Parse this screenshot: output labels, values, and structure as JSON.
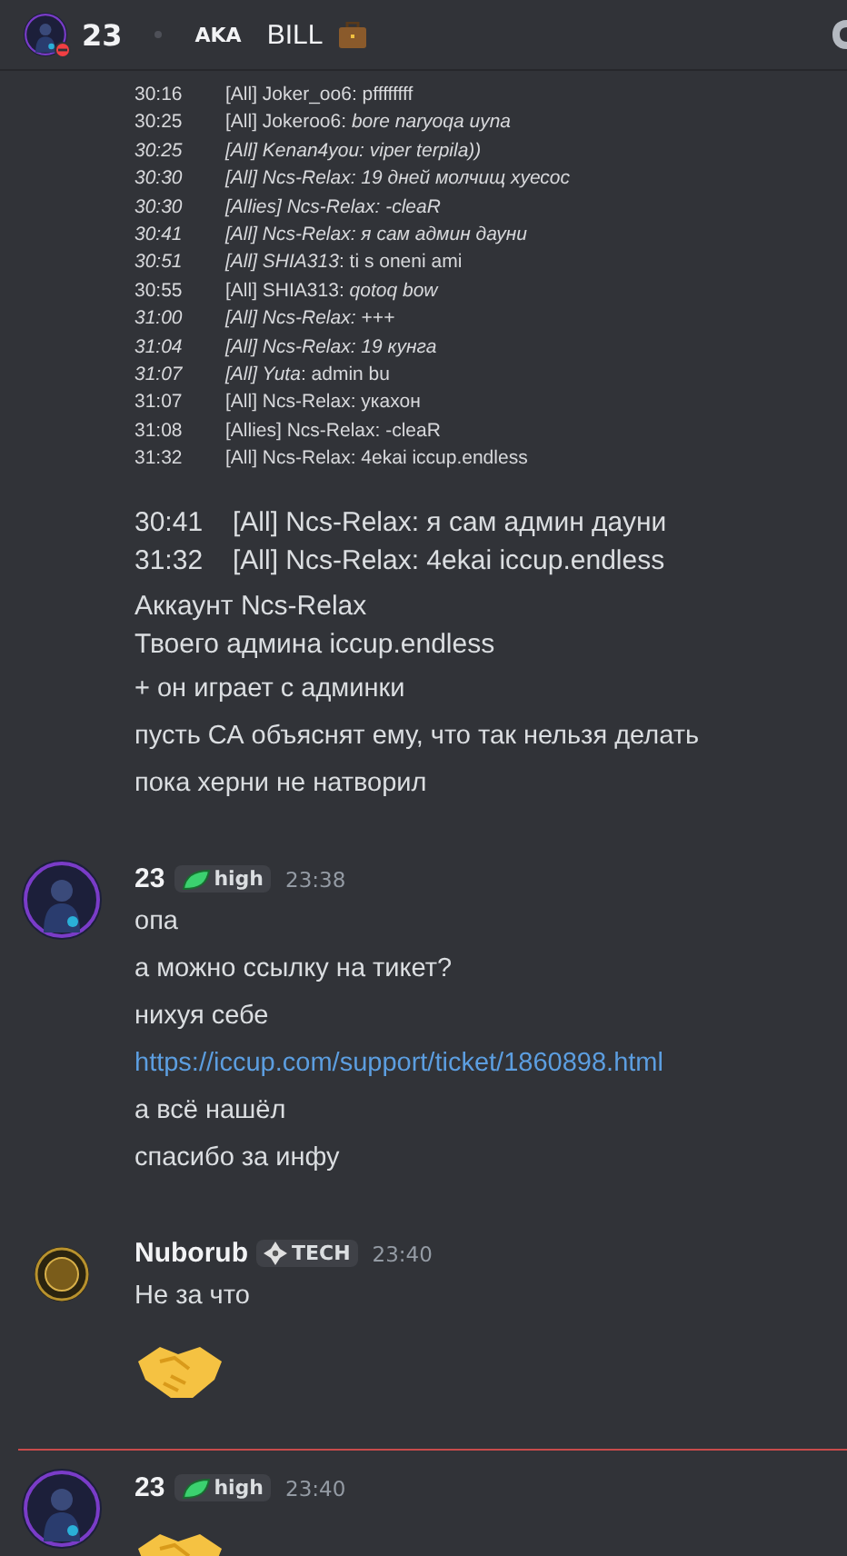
{
  "header": {
    "name": "23",
    "tag": "AKA",
    "nickname": "BILL"
  },
  "screenshot_lines": [
    {
      "time": "30:16",
      "time_italic": false,
      "text": "[All] Joker_oo6: pffffffff",
      "italic": false
    },
    {
      "time": "30:25",
      "time_italic": false,
      "text": "[All] Jokeroo6: *bore naryoqa uyna*",
      "italic": false
    },
    {
      "time": "30:25",
      "time_italic": true,
      "text": "[All] Kenan4you: viper terpila))",
      "italic": true
    },
    {
      "time": "30:30",
      "time_italic": true,
      "text": "[All] Ncs-Relax: 19 дней молчищ хуесос",
      "italic": true
    },
    {
      "time": "30:30",
      "time_italic": true,
      "text": "[Allies] Ncs-Relax: -cleaR",
      "italic": true
    },
    {
      "time": "30:41",
      "time_italic": true,
      "text": "[All] Ncs-Relax: я сам админ дауни",
      "italic": true
    },
    {
      "time": "30:51",
      "time_italic": true,
      "text": "*[All] SHIA313*: ti s oneni ami",
      "italic": false
    },
    {
      "time": "30:55",
      "time_italic": false,
      "text": "[All] SHIA313: *qotoq bow*",
      "italic": false
    },
    {
      "time": "31:00",
      "time_italic": true,
      "text": "[All] Ncs-Relax: +++",
      "italic": true
    },
    {
      "time": "31:04",
      "time_italic": true,
      "text": "[All] Ncs-Relax: 19 кунга",
      "italic": true
    },
    {
      "time": "31:07",
      "time_italic": true,
      "text": "*[All] Yuta*: admin bu",
      "italic": false
    },
    {
      "time": "31:07",
      "time_italic": false,
      "text": "[All] Ncs-Relax: укахон",
      "italic": false
    },
    {
      "time": "31:08",
      "time_italic": false,
      "text": "[Allies] Ncs-Relax: -cleaR",
      "italic": false
    },
    {
      "time": "31:32",
      "time_italic": false,
      "text": "[All] Ncs-Relax: 4ekai iccup.endless",
      "italic": false
    }
  ],
  "continuation": [
    {
      "kind": "quote",
      "lines": [
        {
          "time": "30:41",
          "text": "[All] Ncs-Relax: я сам админ дауни"
        },
        {
          "time": "31:32",
          "text": "[All] Ncs-Relax: 4ekai iccup.endless"
        }
      ]
    },
    {
      "kind": "lines",
      "lines": [
        "Аккаунт Ncs-Relax",
        "Твоего админа  iccup.endless"
      ]
    },
    {
      "kind": "text",
      "text": "+ он играет с админки"
    },
    {
      "kind": "text",
      "text": "пусть СА объяснят ему, что так нельзя делать"
    },
    {
      "kind": "text",
      "text": "пока херни не натворил"
    }
  ],
  "messages": [
    {
      "author": "23",
      "avatar": {
        "kind": "figure"
      },
      "badge": {
        "kind": "leaf",
        "label": "high"
      },
      "time": "23:38",
      "new_divider": false,
      "content": [
        {
          "kind": "text",
          "text": "опа"
        },
        {
          "kind": "text",
          "text": "а можно ссылку на тикет?"
        },
        {
          "kind": "text",
          "text": "нихуя себе"
        },
        {
          "kind": "link",
          "text": "https://iccup.com/support/ticket/1860898.html"
        },
        {
          "kind": "text",
          "text": "а всё нашёл"
        },
        {
          "kind": "text",
          "text": "спасибо за инфу"
        }
      ]
    },
    {
      "author": "Nuborub",
      "avatar": {
        "kind": "vip"
      },
      "badge": {
        "kind": "diamond",
        "label": "TECH"
      },
      "time": "23:40",
      "new_divider": false,
      "content": [
        {
          "kind": "text",
          "text": "Не за что"
        },
        {
          "kind": "emoji"
        }
      ]
    },
    {
      "author": "23",
      "avatar": {
        "kind": "figure"
      },
      "badge": {
        "kind": "leaf",
        "label": "high"
      },
      "time": "23:40",
      "new_divider": true,
      "content": [
        {
          "kind": "emoji"
        }
      ]
    }
  ]
}
